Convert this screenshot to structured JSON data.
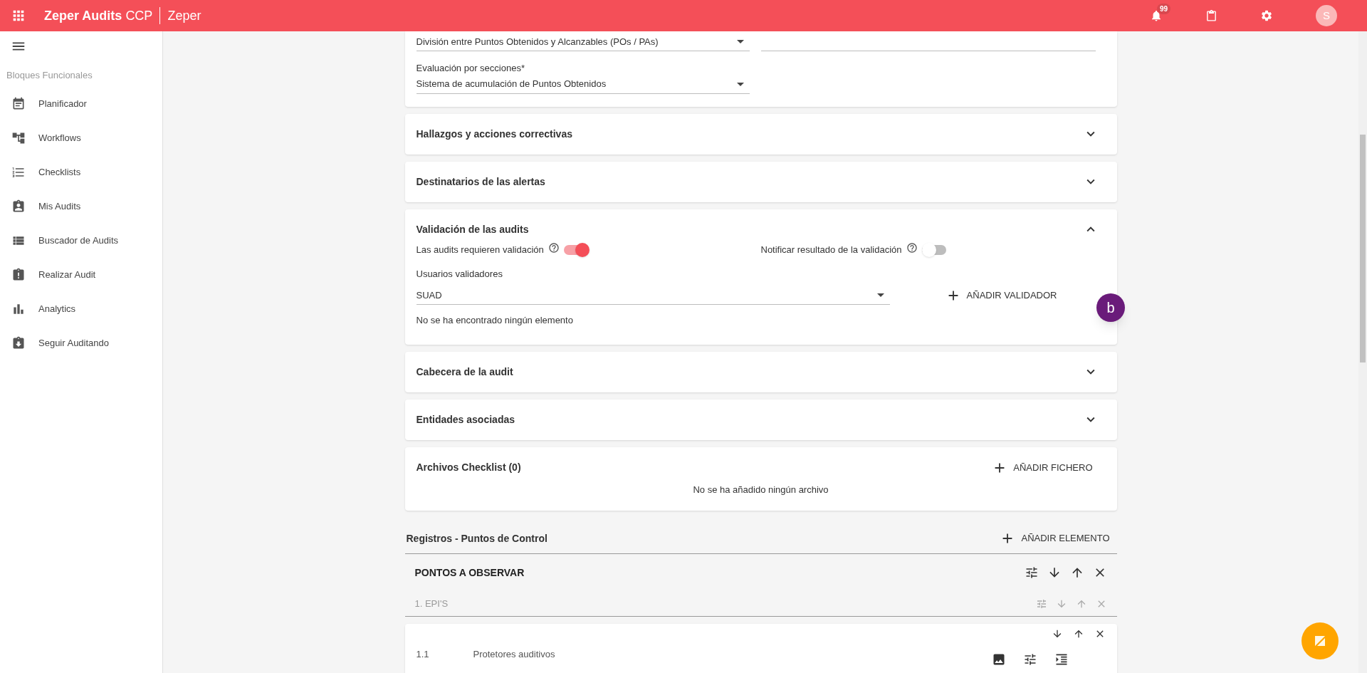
{
  "app_bar": {
    "title": "Zeper Audits",
    "title_suffix": "CCP",
    "org": "Zeper",
    "notifications_badge": "99",
    "avatar_initial": "S"
  },
  "sidebar": {
    "section_label": "Bloques Funcionales",
    "items": [
      {
        "label": "Planificador"
      },
      {
        "label": "Workflows"
      },
      {
        "label": "Checklists"
      },
      {
        "label": "Mis Audits"
      },
      {
        "label": "Buscador de Audits"
      },
      {
        "label": "Realizar Audit"
      },
      {
        "label": "Analytics"
      },
      {
        "label": "Seguir Auditando"
      }
    ]
  },
  "scoring_card": {
    "scoring_value": "División entre Puntos Obtenidos y Alcanzables (POs / PAs)",
    "section_eval_label": "Evaluación por secciones*",
    "section_eval_value": "Sistema de acumulación de Puntos Obtenidos"
  },
  "sections": [
    {
      "title": "Hallazgos y acciones correctivas",
      "expanded": false
    },
    {
      "title": "Destinatarios de las alertas",
      "expanded": false
    },
    {
      "title": "Validación de las audits",
      "expanded": true,
      "content": {
        "toggles": [
          {
            "label": "Las audits requieren validación",
            "on": true
          },
          {
            "label": "Notificar resultado de la validación",
            "on": false
          }
        ],
        "validators_label": "Usuarios validadores",
        "validators_value": "SUAD",
        "add_button": "AÑADIR VALIDADOR",
        "empty_message": "No se ha encontrado ningún elemento"
      }
    },
    {
      "title": "Cabecera de la audit",
      "expanded": false
    },
    {
      "title": "Entidades asociadas",
      "expanded": false
    }
  ],
  "files_card": {
    "title": "Archivos Checklist (0)",
    "add_button": "AÑADIR FICHERO",
    "empty_message": "No se ha añadido ningún archivo"
  },
  "records": {
    "title": "Registros - Puntos de Control",
    "add_button": "AÑADIR ELEMENTO",
    "groups": [
      {
        "title": "PONTOS A OBSERVAR",
        "sections": [
          {
            "title": "1. EPI'S",
            "items": [
              {
                "number": "1.1",
                "label": "Protetores auditivos"
              }
            ]
          }
        ]
      }
    ]
  },
  "floating_badge": "b"
}
